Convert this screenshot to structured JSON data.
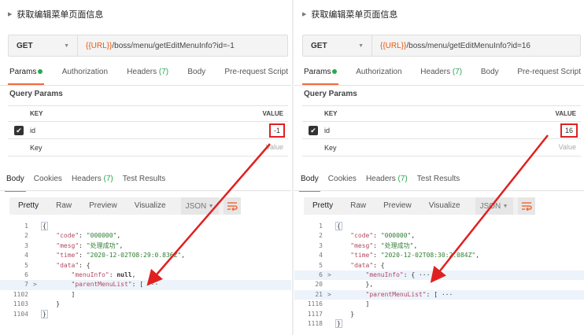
{
  "left": {
    "title": "获取编辑菜单页面信息",
    "method": "GET",
    "url_var": "{{URL}}",
    "url_path": "/boss/menu/getEditMenuInfo?id=-1",
    "request_tabs": [
      {
        "label": "Params",
        "dot": true,
        "active": true
      },
      {
        "label": "Authorization",
        "dot": false,
        "active": false
      },
      {
        "label": "Headers",
        "count": "(7)",
        "active": false
      },
      {
        "label": "Body",
        "dot": false,
        "active": false
      },
      {
        "label": "Pre-request Script",
        "dot": false,
        "active": false
      }
    ],
    "query_params_title": "Query Params",
    "table": {
      "key_header": "KEY",
      "value_header": "VALUE",
      "row_key": "id",
      "row_value": "-1",
      "key_placeholder": "Key",
      "value_placeholder": "Value"
    },
    "response_tabs": [
      {
        "label": "Body",
        "active": true
      },
      {
        "label": "Cookies",
        "active": false
      },
      {
        "label": "Headers",
        "count": "(7)",
        "active": false
      },
      {
        "label": "Test Results",
        "active": false
      }
    ],
    "format_buttons": [
      "Pretty",
      "Raw",
      "Preview",
      "Visualize"
    ],
    "format_select": "JSON",
    "code_lines": [
      {
        "n": "1",
        "parts": [
          {
            "t": "{",
            "c": "bb"
          }
        ]
      },
      {
        "n": "2",
        "parts": [
          {
            "t": "    "
          },
          {
            "t": "\"code\"",
            "c": "k"
          },
          {
            "t": ": "
          },
          {
            "t": "\"000000\"",
            "c": "s"
          },
          {
            "t": ","
          }
        ]
      },
      {
        "n": "3",
        "parts": [
          {
            "t": "    "
          },
          {
            "t": "\"mesg\"",
            "c": "k"
          },
          {
            "t": ": "
          },
          {
            "t": "\"处理成功\"",
            "c": "s"
          },
          {
            "t": ","
          }
        ]
      },
      {
        "n": "4",
        "parts": [
          {
            "t": "    "
          },
          {
            "t": "\"time\"",
            "c": "k"
          },
          {
            "t": ": "
          },
          {
            "t": "\"2020-12-02T08:29:0​.836Z\"",
            "c": "s"
          },
          {
            "t": ","
          }
        ]
      },
      {
        "n": "5",
        "parts": [
          {
            "t": "    "
          },
          {
            "t": "\"data\"",
            "c": "k"
          },
          {
            "t": ": {"
          }
        ]
      },
      {
        "n": "6",
        "parts": [
          {
            "t": "        "
          },
          {
            "t": "\"menuInfo\"",
            "c": "k"
          },
          {
            "t": ": "
          },
          {
            "t": "null",
            "c": "b"
          },
          {
            "t": ","
          }
        ]
      },
      {
        "n": "7",
        "fold": true,
        "hl": true,
        "parts": [
          {
            "t": "        "
          },
          {
            "t": "\"parentMenuList\"",
            "c": "k"
          },
          {
            "t": ": [ ···"
          }
        ]
      },
      {
        "n": "1102",
        "parts": [
          {
            "t": "        ]"
          }
        ]
      },
      {
        "n": "1103",
        "parts": [
          {
            "t": "    }"
          }
        ]
      },
      {
        "n": "1104",
        "parts": [
          {
            "t": "}",
            "c": "bb"
          }
        ]
      }
    ]
  },
  "right": {
    "title": "获取编辑菜单页面信息",
    "method": "GET",
    "url_var": "{{URL}}",
    "url_path": "/boss/menu/getEditMenuInfo?id=16",
    "request_tabs": [
      {
        "label": "Params",
        "dot": true,
        "active": true
      },
      {
        "label": "Authorization",
        "dot": false,
        "active": false
      },
      {
        "label": "Headers",
        "count": "(7)",
        "active": false
      },
      {
        "label": "Body",
        "dot": false,
        "active": false
      },
      {
        "label": "Pre-request Script",
        "dot": false,
        "active": false
      }
    ],
    "query_params_title": "Query Params",
    "table": {
      "key_header": "KEY",
      "value_header": "VALUE",
      "row_key": "id",
      "row_value": "16",
      "key_placeholder": "Key",
      "value_placeholder": "Value"
    },
    "response_tabs": [
      {
        "label": "Body",
        "active": true
      },
      {
        "label": "Cookies",
        "active": false
      },
      {
        "label": "Headers",
        "count": "(7)",
        "active": false
      },
      {
        "label": "Test Results",
        "active": false
      }
    ],
    "format_buttons": [
      "Pretty",
      "Raw",
      "Preview",
      "Visualize"
    ],
    "format_select": "JSON",
    "code_lines": [
      {
        "n": "1",
        "parts": [
          {
            "t": "{",
            "c": "bb"
          }
        ]
      },
      {
        "n": "2",
        "parts": [
          {
            "t": "    "
          },
          {
            "t": "\"code\"",
            "c": "k"
          },
          {
            "t": ": "
          },
          {
            "t": "\"000000\"",
            "c": "s"
          },
          {
            "t": ","
          }
        ]
      },
      {
        "n": "3",
        "parts": [
          {
            "t": "    "
          },
          {
            "t": "\"mesg\"",
            "c": "k"
          },
          {
            "t": ": "
          },
          {
            "t": "\"处理成功\"",
            "c": "s"
          },
          {
            "t": ","
          }
        ]
      },
      {
        "n": "4",
        "parts": [
          {
            "t": "    "
          },
          {
            "t": "\"time\"",
            "c": "k"
          },
          {
            "t": ": "
          },
          {
            "t": "\"2020-12-02T08:30:2​.084Z\"",
            "c": "s"
          },
          {
            "t": ","
          }
        ]
      },
      {
        "n": "5",
        "parts": [
          {
            "t": "    "
          },
          {
            "t": "\"data\"",
            "c": "k"
          },
          {
            "t": ": {"
          }
        ]
      },
      {
        "n": "6",
        "fold": true,
        "hl": true,
        "parts": [
          {
            "t": "        "
          },
          {
            "t": "\"menuInfo\"",
            "c": "k"
          },
          {
            "t": ": { ···"
          }
        ]
      },
      {
        "n": "20",
        "parts": [
          {
            "t": "        },"
          }
        ]
      },
      {
        "n": "21",
        "fold": true,
        "hl": true,
        "parts": [
          {
            "t": "        "
          },
          {
            "t": "\"parentMenuList\"",
            "c": "k"
          },
          {
            "t": ": [ ···"
          }
        ]
      },
      {
        "n": "1116",
        "parts": [
          {
            "t": "        ]"
          }
        ]
      },
      {
        "n": "1117",
        "parts": [
          {
            "t": "    }"
          }
        ]
      },
      {
        "n": "1118",
        "parts": [
          {
            "t": "}",
            "c": "bb"
          }
        ]
      }
    ]
  },
  "colors": {
    "accent": "#f26b3a",
    "annotation": "#e02020",
    "variable": "#e8590c",
    "dot": "#2aa852"
  }
}
